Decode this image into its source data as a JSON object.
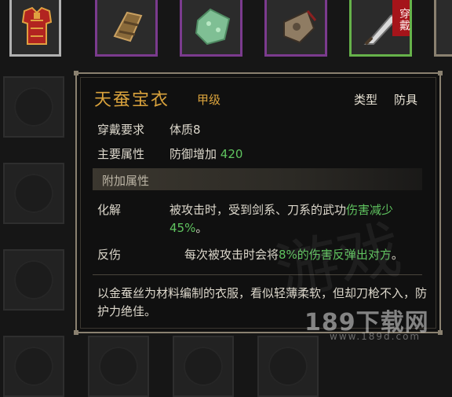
{
  "inventory": {
    "items": [
      {
        "name": "armor-icon",
        "state": "selected"
      },
      {
        "name": "bracer-icon",
        "state": "normal"
      },
      {
        "name": "jade-icon",
        "state": "normal"
      },
      {
        "name": "pouch-icon",
        "state": "normal"
      },
      {
        "name": "blade-icon",
        "state": "equipped",
        "tag": "穿戴"
      },
      {
        "name": "partial-item",
        "state": "normal"
      }
    ],
    "colors": {
      "rare_border": "#7b3b8e",
      "green_border": "#66b24a",
      "selected_border": "#b1b1b1",
      "equip_tag": "#a5141a"
    }
  },
  "tooltip": {
    "name": "天蚕宝衣",
    "grade": "甲级",
    "type_label": "类型",
    "type_value": "防具",
    "requirement_label": "穿戴要求",
    "requirement_value": "体质8",
    "main_attr_label": "主要属性",
    "main_attr_text": "防御增加",
    "main_attr_value": "420",
    "section_title": "附加属性",
    "effects": [
      {
        "label": "化解",
        "text_a": "被攻击时，受到剑系、刀系的武功",
        "highlight": "伤害减少45%",
        "text_b": "。"
      },
      {
        "label": "反伤",
        "text_a": "每次被攻击时会将",
        "highlight": "8%的伤害反弹出对方",
        "text_b": "。"
      }
    ],
    "description": "以金蚕丝为材料编制的衣服，看似轻薄柔软，但却刀枪不入，防护力绝佳。",
    "colors": {
      "title": "#d9a23c",
      "highlight": "#5fc35f",
      "border": "#8a8170"
    }
  },
  "watermark": {
    "brand": "189下载网",
    "url": "www.189d.com",
    "brush": "游戏"
  }
}
